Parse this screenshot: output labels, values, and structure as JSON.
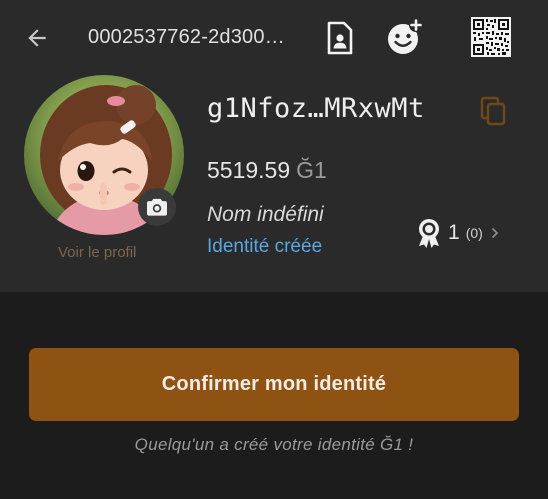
{
  "appbar": {
    "title": "0002537762-2d300…",
    "icons": {
      "back": "arrow-back-icon",
      "document": "document-person-icon",
      "add_contact": "add-reaction-icon",
      "qr": "qr-code-icon"
    }
  },
  "profile": {
    "view_label": "Voir le profil",
    "pubkey_short": "g1Nfoz…MRxwMt",
    "balance_amount": "5519.59",
    "balance_unit": "Ğ1",
    "name": "Nom indéfini",
    "identity_status": "Identité créée",
    "certifications": {
      "count": "1",
      "pending": "(0)"
    }
  },
  "actions": {
    "confirm_label": "Confirmer mon identité",
    "info_text": "Quelqu'un a créé votre identité Ğ1 !"
  },
  "colors": {
    "panel": "#2a2a2a",
    "background": "#1c1c1c",
    "accent_button": "#8e5212",
    "status_link": "#5aa7e0"
  }
}
